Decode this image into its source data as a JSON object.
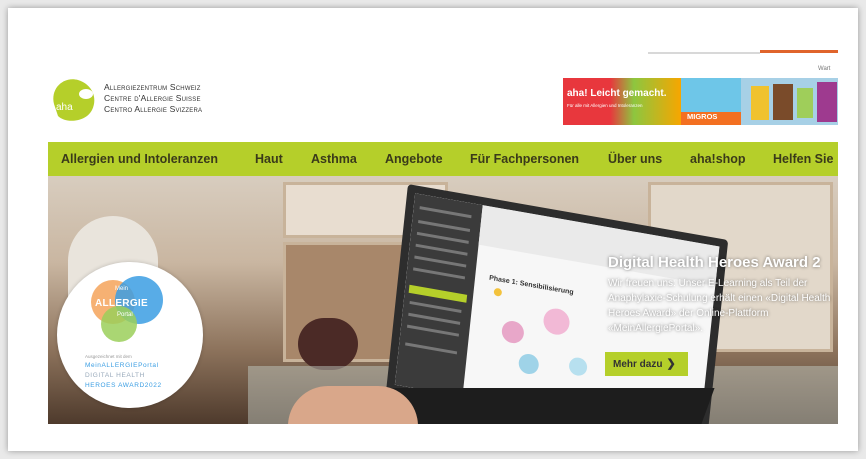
{
  "header": {
    "top_link": "Wart",
    "logo": {
      "mark": "aha",
      "lines": [
        "Allergiezentrum Schweiz",
        "Centre d'Allergie Suisse",
        "Centro Allergie Svizzera"
      ]
    },
    "promo": {
      "headline": "aha! Leicht gemacht.",
      "subline": "Für alle mit Allergien und Intoleranzen",
      "brand": "MIGROS"
    }
  },
  "nav": {
    "items": [
      "Allergien und Intoleranzen",
      "Haut",
      "Asthma",
      "Angebote",
      "Für Fachpersonen",
      "Über uns",
      "aha!shop",
      "Helfen Sie"
    ]
  },
  "hero": {
    "award_badge": {
      "logo_top": "Mein",
      "logo_main": "ALLERGIE",
      "logo_bottom": "Portal",
      "caption": "Ausgezeichnet mit dem",
      "line1": "MeinALLERGIEPortal",
      "line2": "DIGITAL HEALTH",
      "line3": "HEROES AWARD2022"
    },
    "laptop_screen_title": "Phase 1: Sensibilisierung",
    "teaser": {
      "title": "Digital Health Heroes Award 2",
      "body": "Wir freuen uns: Unser E-Learning als Teil der Anaphylaxie-Schulung erhält einen «Digital Health Heroes Award» der Online-Plattform «MeinAllergiePortal».",
      "button_label": "Mehr dazu",
      "button_icon": "chevron-right-icon"
    }
  },
  "colors": {
    "accent_green": "#b5cf2a",
    "accent_orange": "#e0642b",
    "nav_text": "#3a3a1a"
  }
}
